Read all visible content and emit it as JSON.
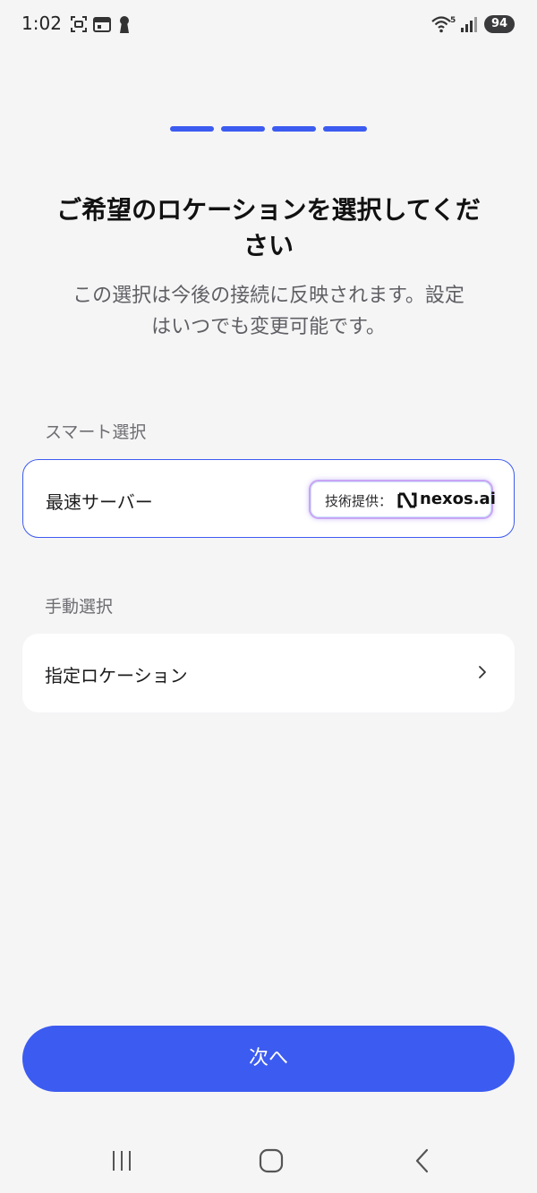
{
  "status_bar": {
    "time": "1:02",
    "wifi_badge": "5",
    "battery": "94",
    "icons": [
      "screenshot-icon",
      "calendar-icon",
      "keyhole-icon",
      "wifi-icon",
      "signal-icon"
    ]
  },
  "progress": {
    "total_steps": 4,
    "current_step": 4,
    "color": "#3c5bf0"
  },
  "header": {
    "title_line1": "ご希望のロケーションを選択してくだ",
    "title_line2": "さい",
    "subtitle_line1": "この選択は今後の接続に反映されます。設定",
    "subtitle_line2": "はいつでも変更可能です。"
  },
  "smart": {
    "section_label": "スマート選択",
    "option_label": "最速サーバー",
    "badge_prefix": "技術提供：",
    "badge_brand": "nexos.ai"
  },
  "manual": {
    "section_label": "手動選択",
    "option_label": "指定ロケーション"
  },
  "footer": {
    "next_label": "次へ"
  },
  "colors": {
    "accent": "#3c5bf0",
    "background": "#f5f5f6",
    "card": "#ffffff"
  }
}
